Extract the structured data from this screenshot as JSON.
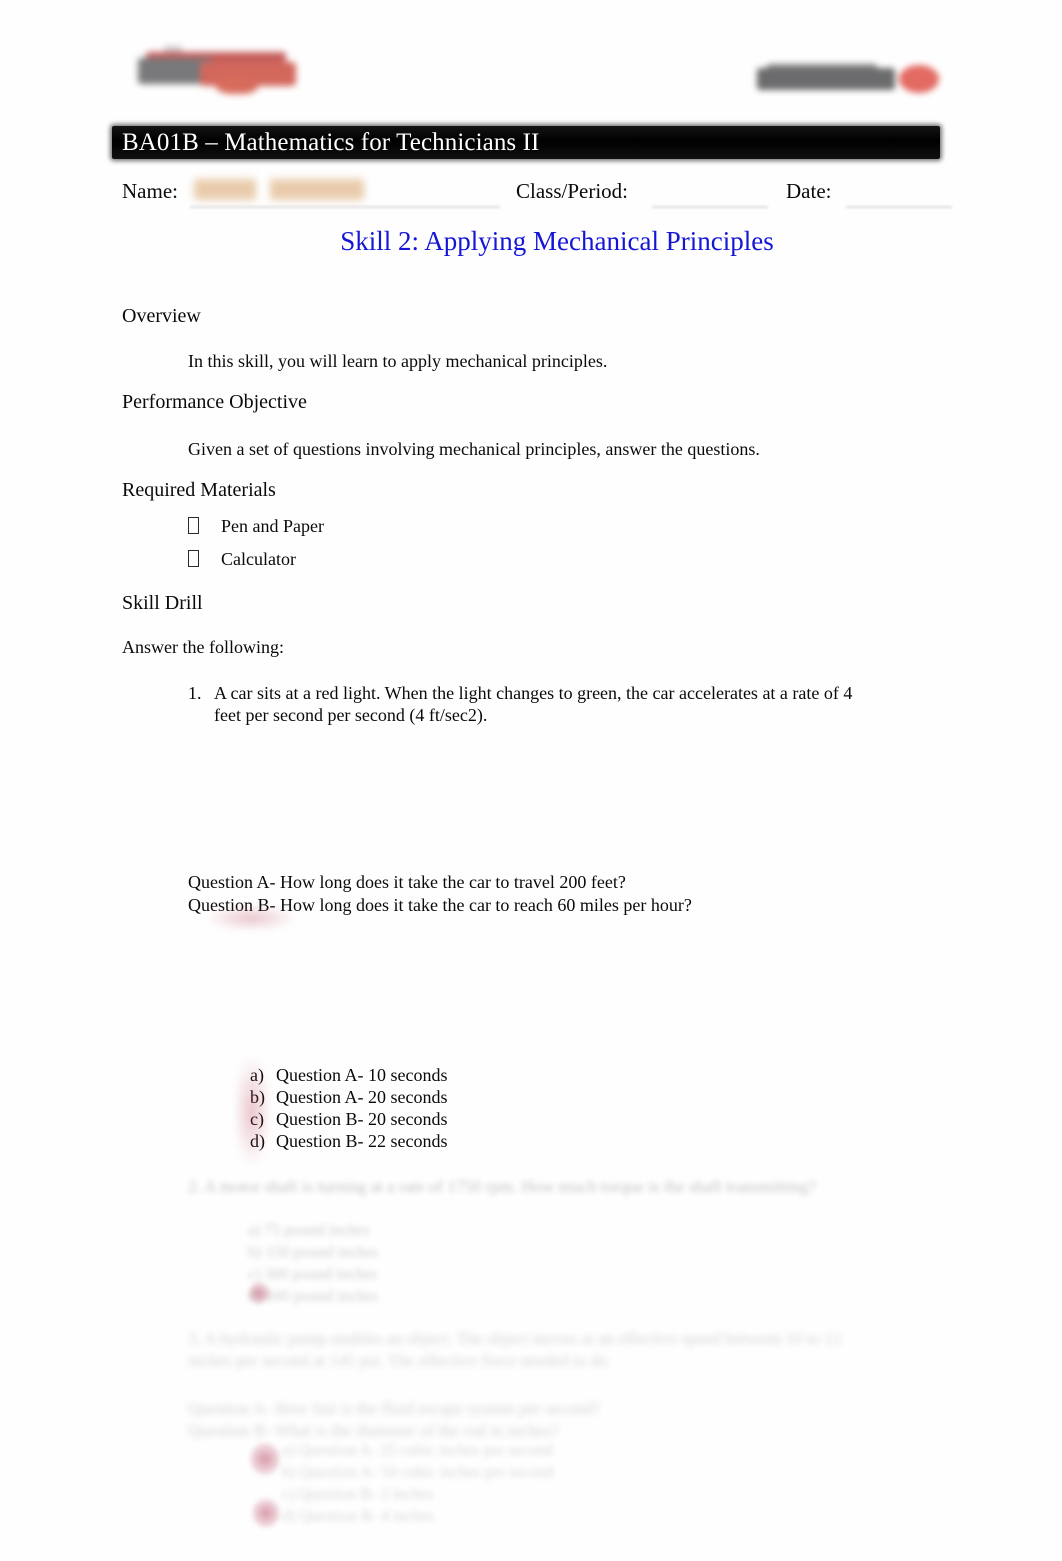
{
  "document": {
    "banner_title": "BA01B  – Mathematics for Technicians II",
    "skill_title": "Skill 2: Applying Mechanical Principles",
    "accent_color": "#1515d6",
    "banner_color": "#000000",
    "logo_left_name": "company-logo-left",
    "logo_right_name": "partner-logo-right"
  },
  "fields": {
    "name_label": "Name:",
    "name_value": "",
    "class_label": "Class/Period:",
    "class_value": "",
    "date_label": "Date:",
    "date_value": ""
  },
  "sections": {
    "overview_heading": "Overview",
    "overview_body": "In this skill, you will learn to apply mechanical principles.",
    "objective_heading": "Performance Objective",
    "objective_body": "Given a set of questions involving mechanical principles, answer the questions.",
    "materials_heading": "Required Materials",
    "materials": [
      "Pen and Paper",
      "Calculator"
    ],
    "drill_heading": "Skill Drill",
    "answer_prompt": "Answer the following:"
  },
  "question1": {
    "number": "1.",
    "line1": "A car sits at a red light. When the light changes to green, the car accelerates at a rate",
    "line2": "of 4 feet per second per second (4 ft/sec2).",
    "question_a": "Question A- How long does it take the car to travel 200 feet?",
    "question_b": "Question B- How long does it take the car to reach 60 miles per hour?",
    "choices": [
      {
        "letter": "a)",
        "text": "Question  A-  10  seconds"
      },
      {
        "letter": "b)",
        "text": "Question  A-  20  seconds"
      },
      {
        "letter": "c)",
        "text": "Question  B-  20  seconds"
      },
      {
        "letter": "d)",
        "text": "Question  B-  22  seconds"
      }
    ]
  },
  "question2_faded": {
    "number": "2.",
    "line1": "A motor shaft is turning at a rate of 1750 rpm. How much torque is the shaft",
    "line2": "transmitting?",
    "choices": [
      "a)  75 pound inches",
      "b)  150 pound inches",
      "c)  300 pound inches",
      "d)  600 pound inches"
    ]
  },
  "question3_faded": {
    "number": "3.",
    "line1": "A hydraulic pump enables an object. The object moves at an effective",
    "line2": "speed between 10 to 12 inches per second at 145 psi. The effective force needed to",
    "line3": "do",
    "question_a": "Question A- How fast is the fluid escape system per second?",
    "question_b": "Question B- What is the diameter of the rod in inches?",
    "choices": [
      "a)  Question A-    25  cubic inches per second",
      "b)  Question A-    50  cubic inches per second",
      "c)  Question B-    2 inches",
      "d)  Question B-    4 inches"
    ]
  }
}
